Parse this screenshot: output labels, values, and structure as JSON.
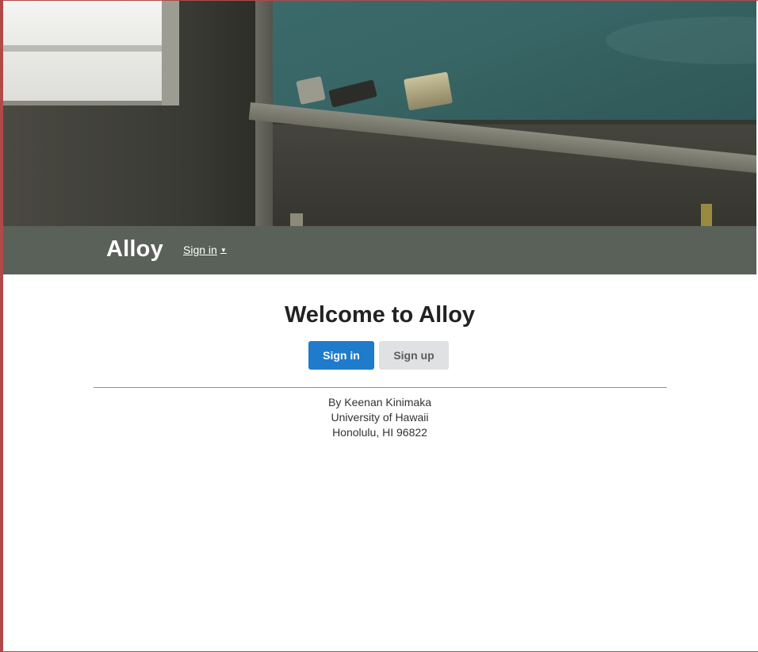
{
  "navbar": {
    "brand": "Alloy",
    "signin_label": "Sign in",
    "signin_caret": "▼"
  },
  "main": {
    "welcome_title": "Welcome to Alloy",
    "signin_button": "Sign in",
    "signup_button": "Sign up"
  },
  "footer": {
    "author": "By Keenan Kinimaka",
    "institution": "University of Hawaii",
    "location": "Honolulu, HI 96822"
  },
  "colors": {
    "navbar_bg": "#5a6158",
    "primary_button": "#1f7bcc",
    "secondary_button": "#e0e1e2"
  },
  "icons": {
    "nav_dropdown": "caret-down-icon"
  }
}
